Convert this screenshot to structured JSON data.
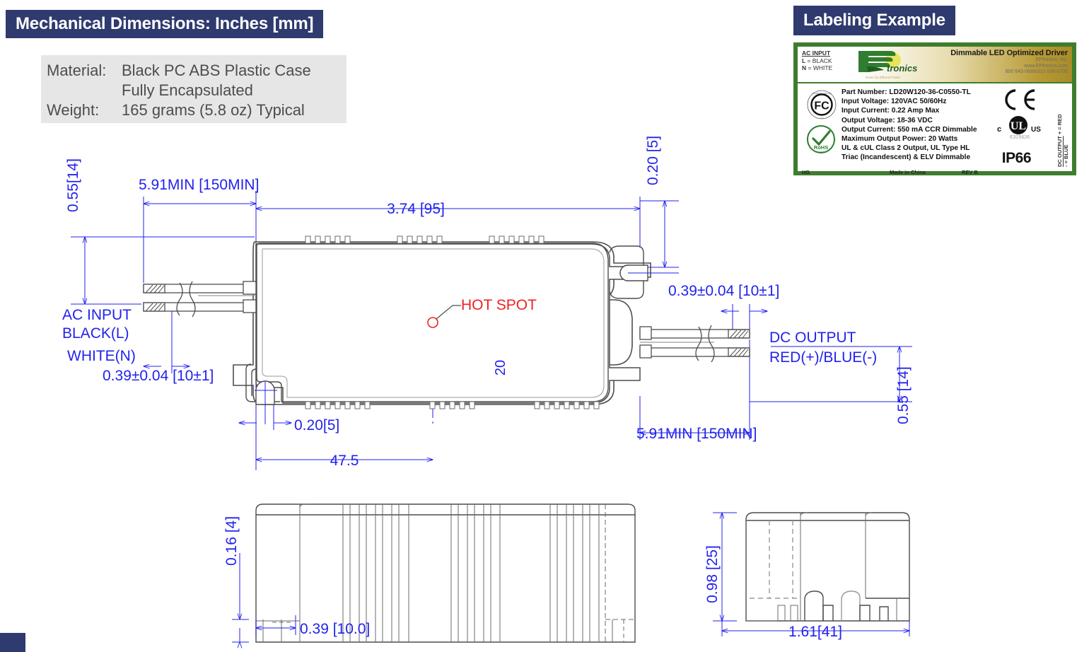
{
  "page": {
    "accent_navy": "#2f3a6e",
    "dim_blue": "#2222ee",
    "hot_red": "#ee2222",
    "label_green": "#3e7d2d"
  },
  "mech_section": {
    "banner_title": "Mechanical Dimensions: Inches [mm]",
    "material_key": "Material:",
    "material_value_line1": "Black PC ABS Plastic Case",
    "material_value_line2": "Fully Encapsulated",
    "weight_key": "Weight:",
    "weight_value": "165 grams (5.8 oz) Typical"
  },
  "label_section": {
    "banner_title": "Labeling Example",
    "ac_input_heading": "AC INPUT",
    "ac_input_l": "L = BLACK",
    "ac_input_n": "N = WHITE",
    "brand": "EPtronics",
    "brand_tagline": "Driven by Efficient Power",
    "headline": "Dimmable LED Optimized Driver",
    "company": "EPtronics, Inc.",
    "website": "www.EPtronics.com",
    "phone": "800 643-0688/310 536-0700",
    "specs": [
      "Part Number: LD20W120-36-C0550-TL",
      "Input Voltage: 120VAC 50/60Hz",
      "Input Current: 0.22 Amp Max",
      "Output Voltage: 18-36 VDC",
      "Output Current: 550 mA CCR Dimmable",
      "Maximum Output Power: 20 Watts",
      "UL & cUL Class 2 Output, UL Type HL",
      "Triac (Incandescent) & ELV Dimmable"
    ],
    "fc_mark": "FC",
    "rohs_mark": "RoHS",
    "ce_mark": "CE",
    "ul_mark_c": "c",
    "ul_mark_us": "US",
    "ul_file": "E325626",
    "ingress_rating": "IP66",
    "dc_output_heading": "DC OUTPUT",
    "dc_output_plus": "+ = RED",
    "dc_output_minus": "- = BLUE",
    "footer_hg": "HG",
    "footer_origin": "Made in China",
    "footer_rev": "REV B"
  },
  "drawing": {
    "top_view": {
      "dim_height_left": "0.55[14]",
      "dim_wire_left": "5.91MIN [150MIN]",
      "dim_body_length": "3.74 [95]",
      "dim_tab_right_top": "0.20 [5]",
      "dim_wire_dia_left": "0.39±0.04 [10±1]",
      "dim_wire_dia_right": "0.39±0.04 [10±1]",
      "dim_tab_left_bottom": "0.20[5]",
      "dim_hotspot_offset": "20",
      "dim_body_inner": "47.5",
      "dim_wire_right": "5.91MIN [150MIN]",
      "dim_height_right": "0.55 [14]",
      "note_hot_spot": "HOT SPOT",
      "label_ac_input_l1": "AC INPUT",
      "label_ac_input_l2": "BLACK(L)",
      "label_ac_input_l3": "WHITE(N)",
      "label_dc_output_l1": "DC OUTPUT",
      "label_dc_output_l2": "RED(+)/BLUE(-)"
    },
    "side_view": {
      "dim_flange_height": "0.16 [4]",
      "dim_flange_width": "0.39 [10.0]"
    },
    "end_view": {
      "dim_height": "0.98 [25]",
      "dim_width": "1.61[41]"
    }
  }
}
